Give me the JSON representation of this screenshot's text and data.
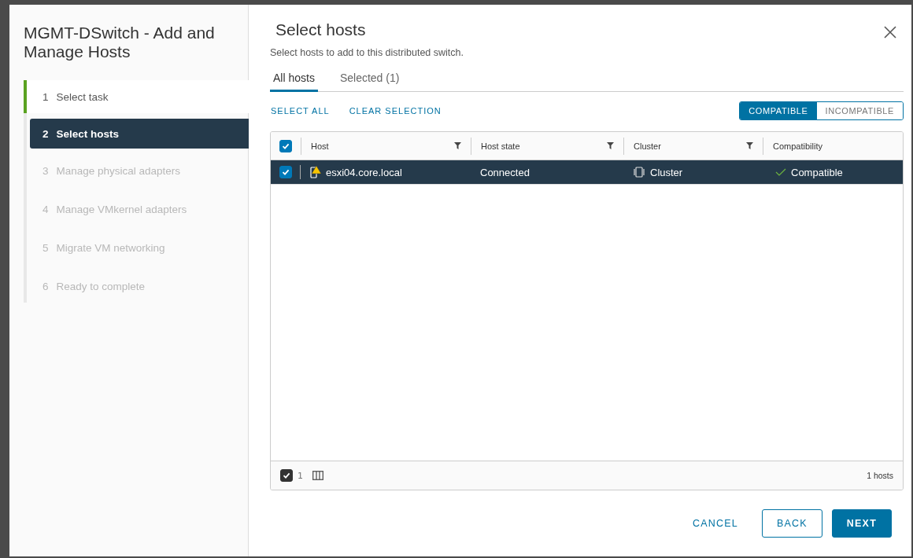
{
  "wizard": {
    "title": "MGMT-DSwitch - Add and Manage Hosts",
    "steps": [
      {
        "number": "1",
        "label": "Select task",
        "completed": true,
        "selected": false,
        "disabled": false
      },
      {
        "number": "2",
        "label": "Select hosts",
        "completed": false,
        "selected": true,
        "disabled": false
      },
      {
        "number": "3",
        "label": "Manage physical adapters",
        "completed": false,
        "selected": false,
        "disabled": true
      },
      {
        "number": "4",
        "label": "Manage VMkernel adapters",
        "completed": false,
        "selected": false,
        "disabled": true
      },
      {
        "number": "5",
        "label": "Migrate VM networking",
        "completed": false,
        "selected": false,
        "disabled": true
      },
      {
        "number": "6",
        "label": "Ready to complete",
        "completed": false,
        "selected": false,
        "disabled": true
      }
    ]
  },
  "page": {
    "title": "Select hosts",
    "description": "Select hosts to add to this distributed switch."
  },
  "tabs": [
    {
      "label": "All hosts",
      "selected": true
    },
    {
      "label": "Selected (1)",
      "selected": false
    }
  ],
  "actions": [
    "SELECT ALL",
    "CLEAR SELECTION"
  ],
  "filter_toggle": [
    {
      "label": "COMPATIBLE",
      "selected": true
    },
    {
      "label": "INCOMPATIBLE",
      "selected": false
    }
  ],
  "table": {
    "select_all_checked": true,
    "columns": [
      {
        "label": "Host",
        "filterable": true
      },
      {
        "label": "Host state",
        "filterable": true
      },
      {
        "label": "Cluster",
        "filterable": true
      },
      {
        "label": "Compatibility",
        "filterable": false
      }
    ],
    "rows": [
      {
        "selected": true,
        "host": "esxi04.core.local",
        "host_warning": true,
        "state": "Connected",
        "cluster": "Cluster",
        "compatibility": "Compatible"
      }
    ],
    "footer": {
      "selected_count": "1",
      "total": "1 hosts"
    }
  },
  "buttons": [
    {
      "label": "CANCEL",
      "kind": "link"
    },
    {
      "label": "BACK",
      "kind": "outline"
    },
    {
      "label": "NEXT",
      "kind": "primary"
    }
  ]
}
